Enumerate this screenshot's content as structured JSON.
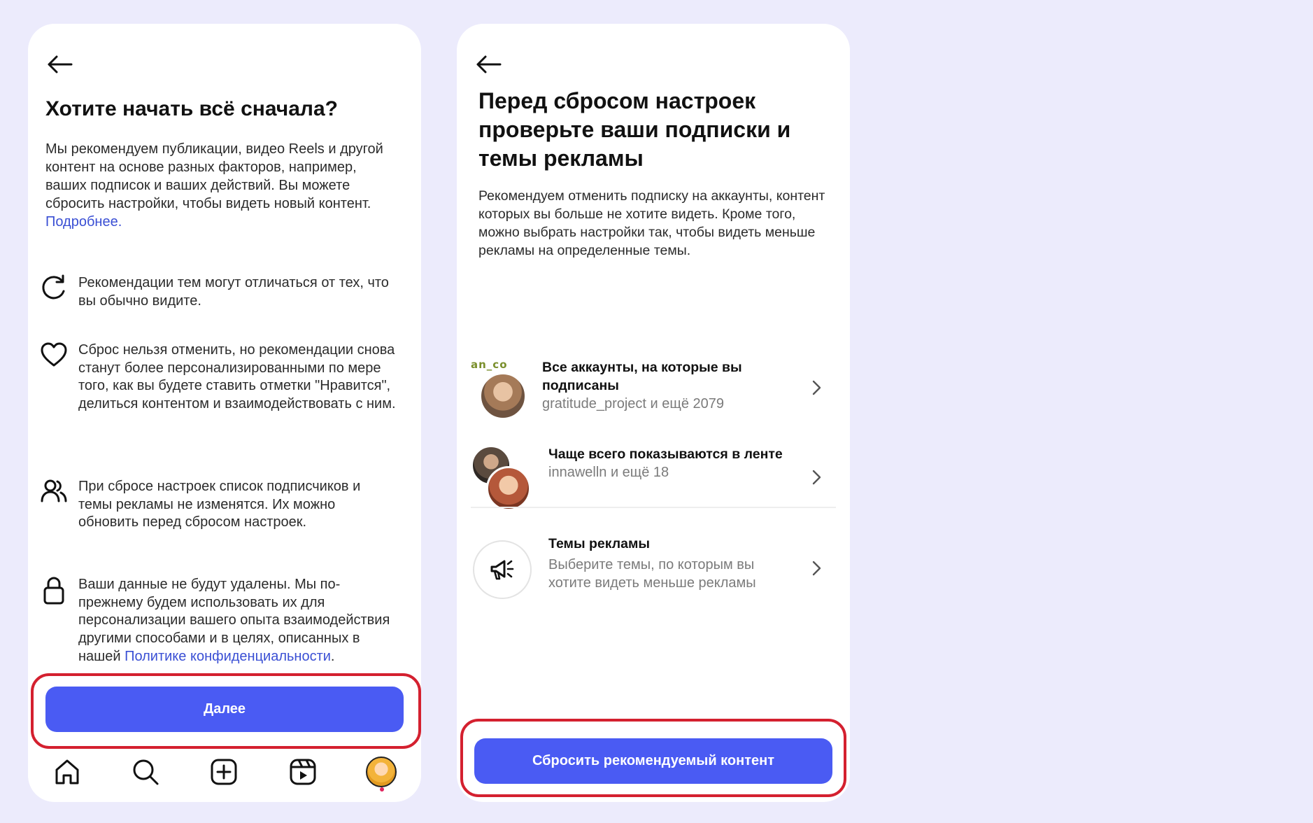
{
  "screen1": {
    "title": "Хотите начать всё сначала?",
    "intro": "Мы рекомендуем публикации, видео Reels и другой контент на основе разных факторов, например, ваших подписок и ваших действий. Вы можете сбросить настройки, чтобы видеть новый контент.",
    "more_link": "Подробнее.",
    "features": [
      {
        "icon": "refresh-icon",
        "text": "Рекомендации тем могут отличаться от тех, что вы обычно видите."
      },
      {
        "icon": "heart-icon",
        "text": "Сброс нельзя отменить, но рекомендации снова станут более персонализированными по мере того, как вы будете ставить отметки \"Нравится\", делиться контентом и взаимодействовать с ним."
      },
      {
        "icon": "people-icon",
        "text": "При сбросе настроек список подписчиков и темы рекламы не изменятся. Их можно обновить перед сбросом настроек."
      },
      {
        "icon": "lock-icon",
        "text": "Ваши данные не будут удалены. Мы по-прежнему будем использовать их для персонализации вашего опыта взаимодействия другими способами и в целях, описанных в нашей",
        "link": "Политике конфиденциальности",
        "after": "."
      }
    ],
    "next_button": "Далее",
    "nav": [
      "home-icon",
      "search-icon",
      "create-icon",
      "reels-icon",
      "profile-avatar"
    ]
  },
  "screen2": {
    "title": "Перед сбросом настроек проверьте ваши подписки и темы рекламы",
    "intro": "Рекомендуем отменить подписку на аккаунты, контент которых вы больше не хотите видеть. Кроме того, можно выбрать настройки так, чтобы видеть меньше рекламы на определенные темы.",
    "rows": [
      {
        "title": "Все аккаунты, на которые вы подписаны",
        "subtitle": "gratitude_project и ещё 2079",
        "logo_text": "an_co"
      },
      {
        "title": "Чаще всего показываются в ленте",
        "subtitle": "innawelln и ещё 18"
      },
      {
        "title": "Темы рекламы",
        "subtitle": "Выберите темы, по которым вы хотите видеть меньше рекламы"
      }
    ],
    "reset_button": "Сбросить рекомендуемый контент"
  },
  "colors": {
    "background": "#ecebfc",
    "primary": "#4a5bf3",
    "highlight": "#d4202f",
    "link": "#3a4fd4"
  }
}
